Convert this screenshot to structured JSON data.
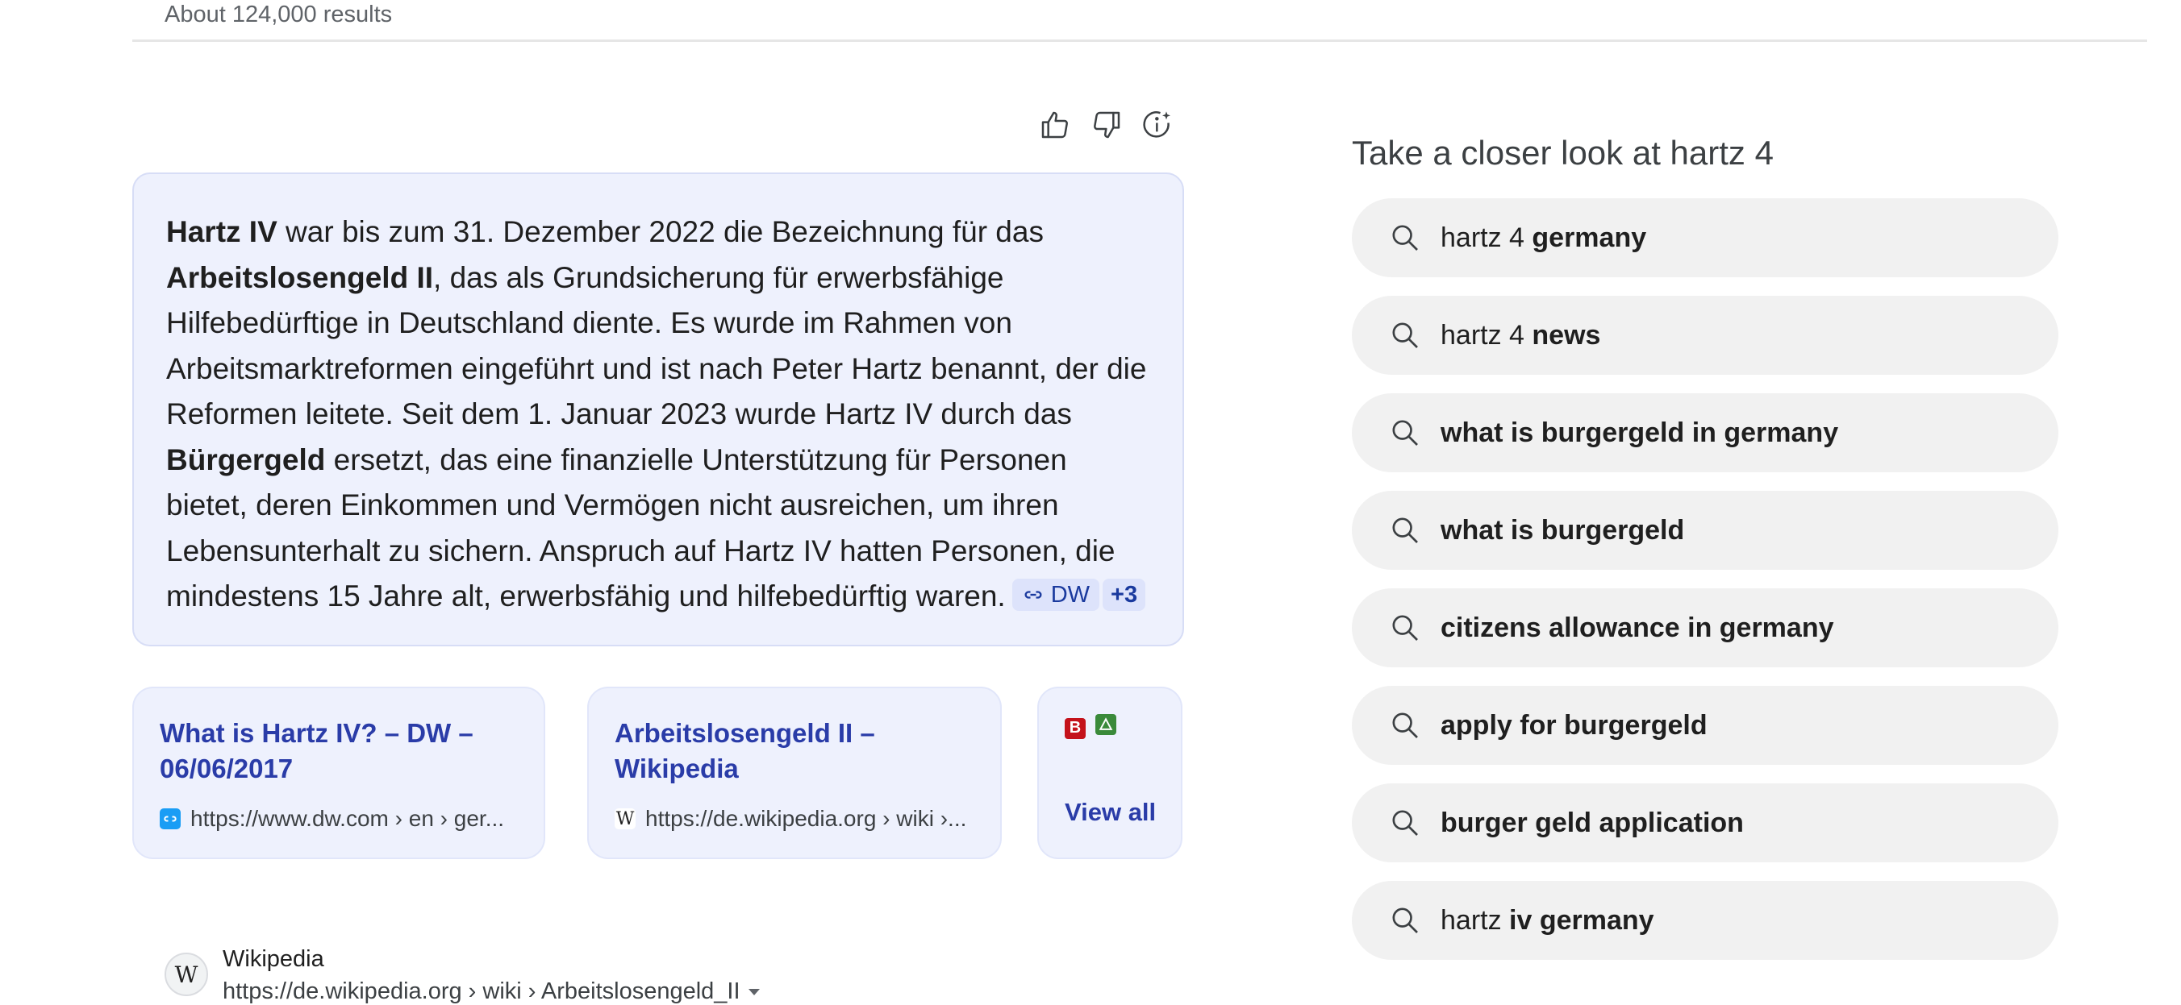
{
  "header": {
    "result_count": "About 124,000 results"
  },
  "feedback": {
    "thumbs_up_icon": "thumbs-up-icon",
    "thumbs_down_icon": "thumbs-down-icon",
    "info_icon": "info-sparkle-icon"
  },
  "answer": {
    "segments": [
      {
        "text": "Hartz IV",
        "bold": true
      },
      {
        "text": " war bis zum 31. Dezember 2022 die Bezeichnung für das ",
        "bold": false
      },
      {
        "text": "Arbeitslosengeld II",
        "bold": true
      },
      {
        "text": ", das als Grundsicherung für erwerbsfähige Hilfebedürftige in Deutschland diente. Es wurde im Rahmen von Arbeitsmarktreformen eingeführt und ist nach Peter Hartz benannt, der die Reformen leitete. Seit dem 1. Januar 2023 wurde Hartz IV durch das ",
        "bold": false
      },
      {
        "text": "Bürgergeld",
        "bold": true
      },
      {
        "text": " ersetzt, das eine finanzielle Unterstützung für Personen bietet, deren Einkommen und Vermögen nicht ausreichen, um ihren Lebensunterhalt zu sichern. Anspruch auf Hartz IV hatten Personen, die mindestens 15 Jahre alt, erwerbsfähig und hilfebedürftig waren.",
        "bold": false
      }
    ],
    "source_chip": "DW",
    "more_chip": "+3"
  },
  "cards": [
    {
      "title": "What is Hartz IV? – DW – 06/06/2017",
      "favicon": "dw-icon",
      "url": "https://www.dw.com › en › ger..."
    },
    {
      "title": "Arbeitslosengeld II – Wikipedia",
      "favicon": "wikipedia-icon",
      "favicon_glyph": "W",
      "url": "https://de.wikipedia.org › wiki ›..."
    }
  ],
  "view_all": {
    "label": "View all",
    "fav1": "B",
    "fav1_color": "#c4121b",
    "fav2_color": "#3a8a3a"
  },
  "wiki_result": {
    "logo": "W",
    "name": "Wikipedia",
    "url": "https://de.wikipedia.org › wiki › Arbeitslosengeld_II"
  },
  "related": {
    "title": "Take a closer look at hartz 4",
    "items": [
      {
        "plain": "hartz 4 ",
        "bold": "germany"
      },
      {
        "plain": "hartz 4 ",
        "bold": "news"
      },
      {
        "plain": "",
        "bold": "what is burgergeld in germany"
      },
      {
        "plain": "",
        "bold": "what is burgergeld"
      },
      {
        "plain": "",
        "bold": "citizens allowance in germany"
      },
      {
        "plain": "",
        "bold": "apply for burgergeld"
      },
      {
        "plain": "",
        "bold": "burger geld application"
      },
      {
        "plain": "hartz ",
        "bold": "iv germany"
      }
    ]
  },
  "colors": {
    "accent": "#2a3ca8",
    "answer_bg": "#eef1fd",
    "chip_bg": "#dde3fb",
    "suggestion_bg": "#f1f1f1"
  }
}
